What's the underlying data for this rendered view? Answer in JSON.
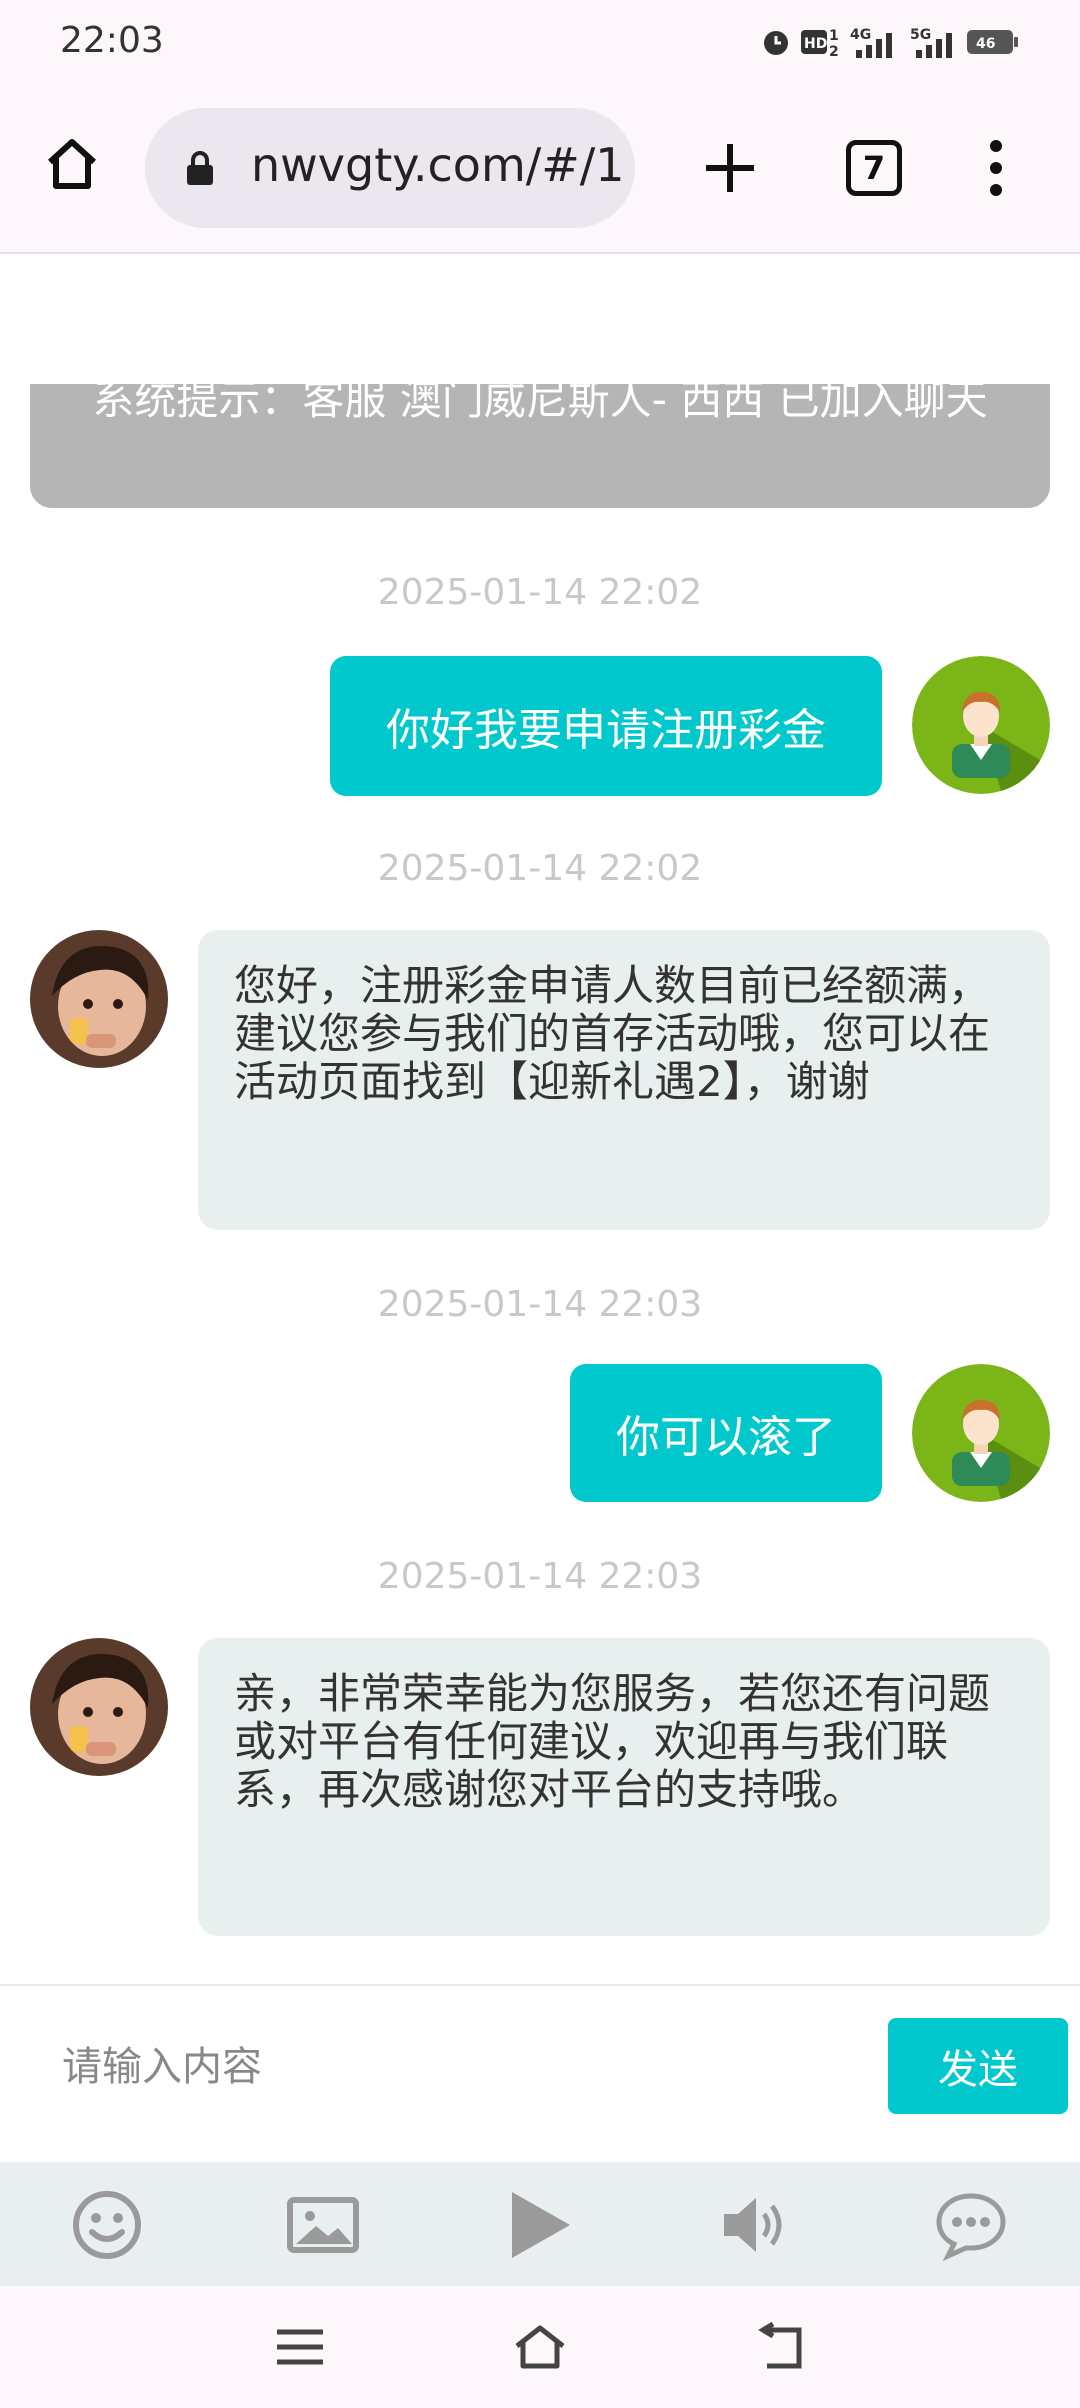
{
  "status_bar": {
    "time": "22:03",
    "battery": "46"
  },
  "browser": {
    "url": "nwvgty.com/#/1",
    "tab_count": "7"
  },
  "chat": {
    "system_notice": "系统提示：客服 澳门威尼斯人- 西西 已加入聊天",
    "messages": [
      {
        "timestamp": "2025-01-14 22:02",
        "side": "outgoing",
        "text": "你好我要申请注册彩金"
      },
      {
        "timestamp": "2025-01-14 22:02",
        "side": "incoming",
        "text": "您好，注册彩金申请人数目前已经额满，建议您参与我们的首存活动哦，您可以在活动页面找到【迎新礼遇2】，谢谢"
      },
      {
        "timestamp": "2025-01-14 22:03",
        "side": "outgoing",
        "text": "你可以滚了"
      },
      {
        "timestamp": "2025-01-14 22:03",
        "side": "incoming",
        "text": "亲，非常荣幸能为您服务，若您还有问题或对平台有任何建议，欢迎再与我们联系，再次感谢您对平台的支持哦。"
      }
    ]
  },
  "composer": {
    "placeholder": "请输入内容",
    "send_label": "发送"
  },
  "toolbar_icons": [
    "emoji-icon",
    "image-icon",
    "play-icon",
    "speaker-icon",
    "chat-icon"
  ],
  "colors": {
    "accent": "#00c8cc",
    "system_notice_bg": "#b5b5b5",
    "incoming_bubble_bg": "#e8efef",
    "avatar_green": "#7cb518"
  }
}
